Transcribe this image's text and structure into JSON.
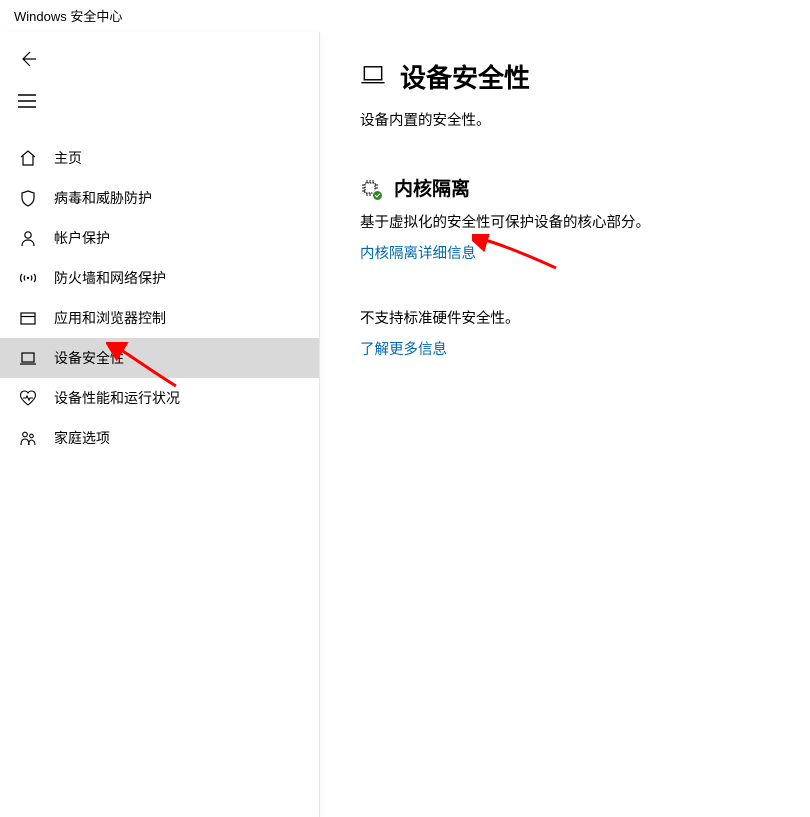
{
  "window": {
    "title": "Windows 安全中心"
  },
  "sidebar": {
    "items": [
      {
        "label": "主页"
      },
      {
        "label": "病毒和威胁防护"
      },
      {
        "label": "帐户保护"
      },
      {
        "label": "防火墙和网络保护"
      },
      {
        "label": "应用和浏览器控制"
      },
      {
        "label": "设备安全性"
      },
      {
        "label": "设备性能和运行状况"
      },
      {
        "label": "家庭选项"
      }
    ]
  },
  "main": {
    "title": "设备安全性",
    "subtitle": "设备内置的安全性。",
    "section1": {
      "title": "内核隔离",
      "desc": "基于虚拟化的安全性可保护设备的核心部分。",
      "link": "内核隔离详细信息"
    },
    "section2": {
      "desc": "不支持标准硬件安全性。",
      "link": "了解更多信息"
    }
  },
  "colors": {
    "link": "#0066b4",
    "selected": "#d9d9d9",
    "annotation": "#ff0000",
    "badge": "#2e8b1f"
  }
}
